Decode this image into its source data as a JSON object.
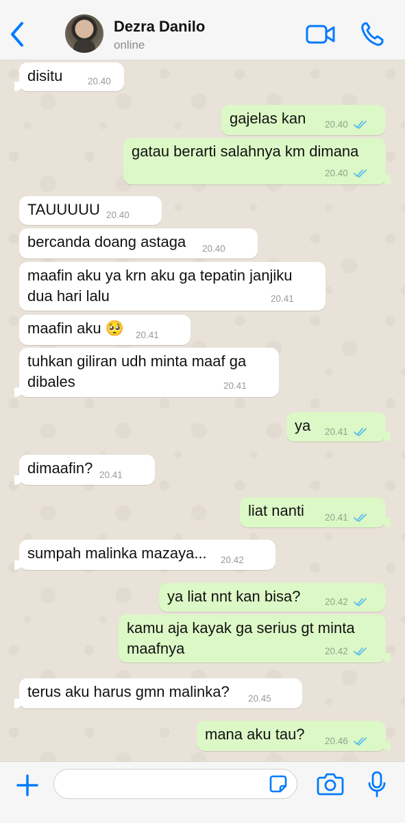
{
  "header": {
    "name": "Dezra Danilo",
    "status": "online"
  },
  "messages": [
    {
      "dir": "in",
      "text": "disitu",
      "time": "20.40"
    },
    {
      "dir": "out",
      "text": "gajelas kan",
      "time": "20.40"
    },
    {
      "dir": "out",
      "text": "gatau berarti salahnya km dimana",
      "time": "20.40"
    },
    {
      "dir": "in",
      "text": "TAUUUUU",
      "time": "20.40"
    },
    {
      "dir": "in",
      "text": "bercanda doang astaga",
      "time": "20.40"
    },
    {
      "dir": "in",
      "text": "maafin aku ya krn aku ga tepatin janjiku\ndua hari lalu",
      "time": "20.41"
    },
    {
      "dir": "in",
      "text": "maafin aku 🥺",
      "time": "20.41"
    },
    {
      "dir": "in",
      "text": "tuhkan giliran udh minta maaf ga\ndibales",
      "time": "20.41"
    },
    {
      "dir": "out",
      "text": "ya",
      "time": "20.41"
    },
    {
      "dir": "in",
      "text": "dimaafin?",
      "time": "20.41"
    },
    {
      "dir": "out",
      "text": "liat nanti",
      "time": "20.41"
    },
    {
      "dir": "in",
      "text": "sumpah malinka mazaya...",
      "time": "20.42"
    },
    {
      "dir": "out",
      "text": "ya liat nnt kan bisa?",
      "time": "20.42"
    },
    {
      "dir": "out",
      "text": "kamu aja kayak ga serius gt minta\nmaafnya",
      "time": "20.42"
    },
    {
      "dir": "in",
      "text": "terus aku harus gmn malinka?",
      "time": "20.45"
    },
    {
      "dir": "out",
      "text": "mana aku tau?",
      "time": "20.46"
    }
  ],
  "composer": {
    "value": ""
  },
  "colors": {
    "accent": "#007aff",
    "outgoing_bubble": "#dcf8c6",
    "incoming_bubble": "#ffffff",
    "read_ticks": "#53bdeb"
  },
  "icons": {
    "back": "chevron-left-icon",
    "video": "video-camera-icon",
    "call": "phone-icon",
    "plus": "plus-icon",
    "sticker": "sticker-icon",
    "camera": "camera-icon",
    "mic": "microphone-icon",
    "read": "double-check-icon"
  }
}
